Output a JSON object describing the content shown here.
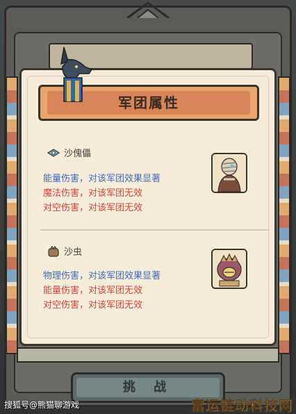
{
  "panel": {
    "title": "军团属性"
  },
  "units": [
    {
      "name": "沙傀儡",
      "lines": [
        {
          "text": "能量伤害，对该军团效果显著",
          "tone": "blue"
        },
        {
          "text": "魔法伤害，对该军团无效",
          "tone": "red"
        },
        {
          "text": "对空伤害，对该军团无效",
          "tone": "red"
        }
      ]
    },
    {
      "name": "沙虫",
      "lines": [
        {
          "text": "物理伤害，对该军团效果显著",
          "tone": "blue"
        },
        {
          "text": "能量伤害，对该军团无效",
          "tone": "red"
        },
        {
          "text": "对空伤害，对该军团无效",
          "tone": "red"
        }
      ]
    }
  ],
  "footer": {
    "challenge_label": "挑 战"
  },
  "watermarks": {
    "left": "搜狐号@熊猫聊游戏",
    "right": "富运链动科技网"
  },
  "colors": {
    "effective": "#3f6bc2",
    "ineffective": "#d3443c",
    "banner": "#d9855a",
    "parchment": "#f5ecd9"
  },
  "icons": [
    "anubis-icon",
    "golem-unit-icon",
    "sandworm-unit-icon",
    "golem-portrait",
    "sandworm-portrait"
  ]
}
